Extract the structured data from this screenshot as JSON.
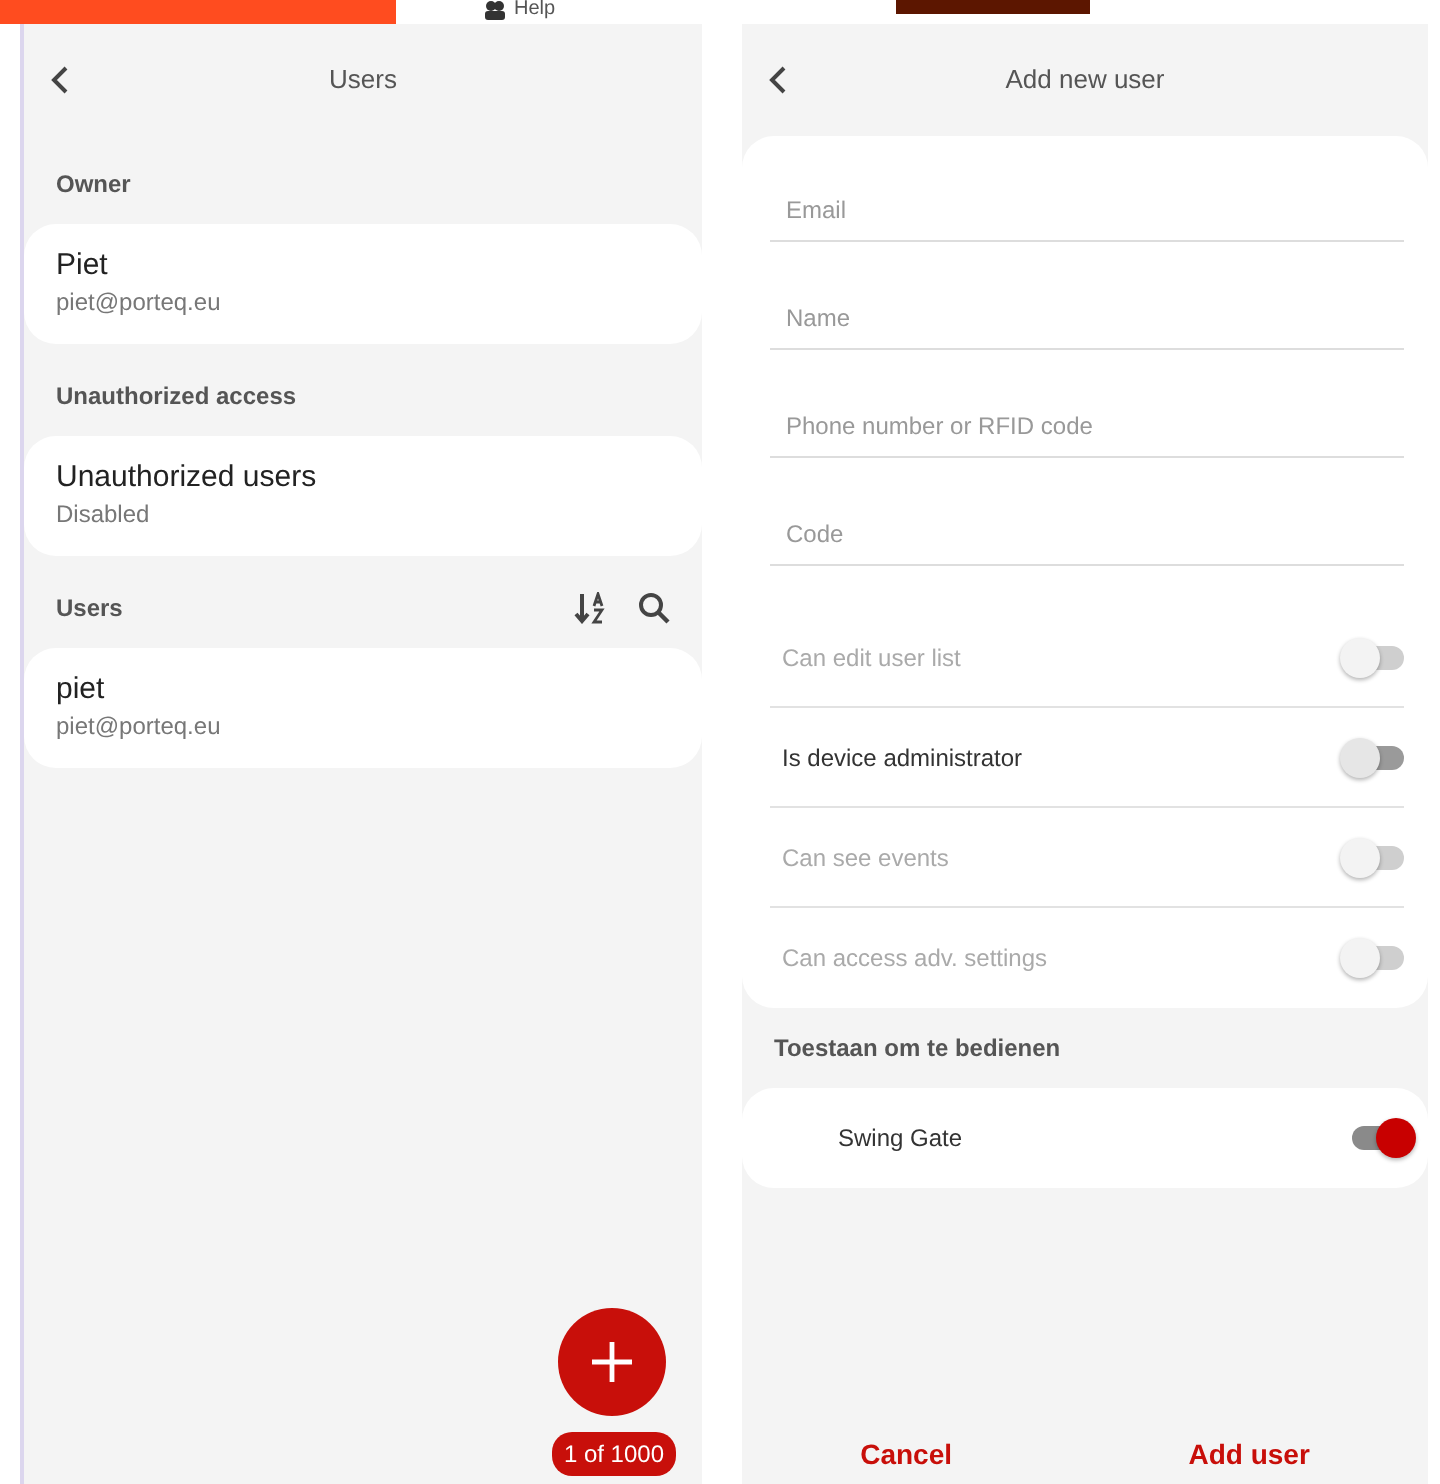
{
  "top_bar": {
    "help_label": "Help"
  },
  "users_screen": {
    "title": "Users",
    "sections": [
      {
        "label": "Owner",
        "has_tools": false,
        "items": [
          {
            "name": "Piet",
            "detail": "piet@porteq.eu"
          }
        ]
      },
      {
        "label": "Unauthorized access",
        "has_tools": false,
        "items": [
          {
            "name": "Unauthorized users",
            "detail": "Disabled"
          }
        ]
      },
      {
        "label": "Users",
        "has_tools": true,
        "items": [
          {
            "name": "piet",
            "detail": "piet@porteq.eu"
          }
        ]
      }
    ],
    "pager": "1 of 1000"
  },
  "add_user_screen": {
    "title": "Add new user",
    "fields": [
      {
        "placeholder": "Email"
      },
      {
        "placeholder": "Name"
      },
      {
        "placeholder": "Phone number or RFID code"
      },
      {
        "placeholder": "Code"
      }
    ],
    "toggles": [
      {
        "label": "Can edit user list",
        "disabled": true,
        "on": false
      },
      {
        "label": "Is device administrator",
        "disabled": false,
        "on": false
      },
      {
        "label": "Can see events",
        "disabled": true,
        "on": false
      },
      {
        "label": "Can access adv. settings",
        "disabled": true,
        "on": false
      }
    ],
    "operate_section": {
      "label": "Toestaan om te bedienen",
      "items": [
        {
          "label": "Swing Gate",
          "disabled": false,
          "on": true
        }
      ]
    },
    "buttons": [
      "Cancel",
      "Add user"
    ]
  }
}
